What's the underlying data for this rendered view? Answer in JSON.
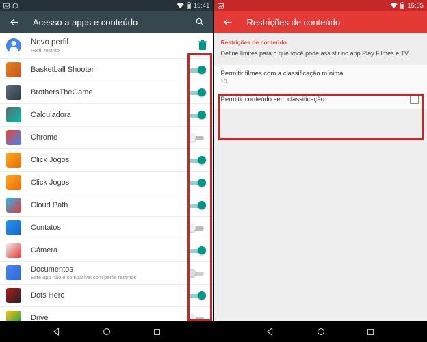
{
  "left": {
    "statusbar": {
      "icons": [
        "screenshot-icon",
        "package-icon",
        "wifi-icon",
        "battery-icon"
      ],
      "clock": "15:41",
      "bg": "#263238"
    },
    "appbar": {
      "title": "Acesso a apps e conteúdo",
      "back_icon": "back-arrow-icon",
      "search_icon": "search-icon",
      "bg": "#37474F"
    },
    "profile": {
      "name": "Novo perfil",
      "subtitle": "Perfil restrito",
      "avatar_icon": "person-avatar-icon",
      "delete_icon": "trash-icon",
      "delete_color": "#009688"
    },
    "apps": [
      {
        "name": "Basketball Shooter",
        "sub": "",
        "state": "on",
        "icon_colors": [
          "#E8821E",
          "#C2561A"
        ]
      },
      {
        "name": "BrothersTheGame",
        "sub": "",
        "state": "on",
        "icon_colors": [
          "#5D6B7A",
          "#2F3A45"
        ]
      },
      {
        "name": "Calculadora",
        "sub": "",
        "state": "on",
        "icon_colors": [
          "#5F6B74",
          "#00BFA5"
        ]
      },
      {
        "name": "Chrome",
        "sub": "",
        "state": "off",
        "icon_colors": [
          "#EA4335",
          "#4285F4"
        ]
      },
      {
        "name": "Click Jogos",
        "sub": "",
        "state": "on",
        "icon_colors": [
          "#F9A825",
          "#EF6C00"
        ]
      },
      {
        "name": "Click Jogos",
        "sub": "",
        "state": "on",
        "icon_colors": [
          "#F9A825",
          "#EF6C00"
        ]
      },
      {
        "name": "Cloud Path",
        "sub": "",
        "state": "on",
        "icon_colors": [
          "#29B6F6",
          "#E53935"
        ]
      },
      {
        "name": "Contatos",
        "sub": "",
        "state": "off",
        "icon_colors": [
          "#2196F3",
          "#1565C0"
        ]
      },
      {
        "name": "Câmera",
        "sub": "",
        "state": "on",
        "icon_colors": [
          "#ECEFF1",
          "#E53935"
        ]
      },
      {
        "name": "Documentos",
        "sub": "Este app não é compatível com perfis restritos",
        "state": "disabled",
        "icon_colors": [
          "#4285F4",
          "#3367D6"
        ]
      },
      {
        "name": "Dots Hero",
        "sub": "",
        "state": "on",
        "icon_colors": [
          "#B71C1C",
          "#212121"
        ]
      },
      {
        "name": "Drive",
        "sub": "",
        "state": "off",
        "icon_colors": [
          "#FFC107",
          "#0F9D58"
        ]
      }
    ],
    "navbar": {
      "back": "nav-back-icon",
      "home": "nav-home-icon",
      "recents": "nav-recents-icon"
    }
  },
  "right": {
    "statusbar": {
      "icons": [
        "screenshot-icon",
        "wifi-icon",
        "battery-icon"
      ],
      "clock": "16:05",
      "bg": "#C62828"
    },
    "appbar": {
      "title": "Restrições de conteúdo",
      "back_icon": "back-arrow-icon",
      "bg": "#E53935"
    },
    "section": {
      "header": "Restrições de conteúdo",
      "description": "Define limites para o que você pode assistir no app Play Filmes e TV."
    },
    "prefs": [
      {
        "title": "Permitir filmes com a classificação mínima",
        "value": "10",
        "control": "none"
      },
      {
        "title": "Permitir conteúdo sem classificação",
        "value": "",
        "control": "checkbox-unchecked"
      }
    ],
    "navbar": {
      "back": "nav-back-icon",
      "home": "nav-home-icon",
      "recents": "nav-recents-icon"
    }
  },
  "annotations": {
    "color": "#C62828",
    "boxes": [
      {
        "name": "left-toggles-highlight"
      },
      {
        "name": "right-prefs-highlight"
      }
    ]
  }
}
